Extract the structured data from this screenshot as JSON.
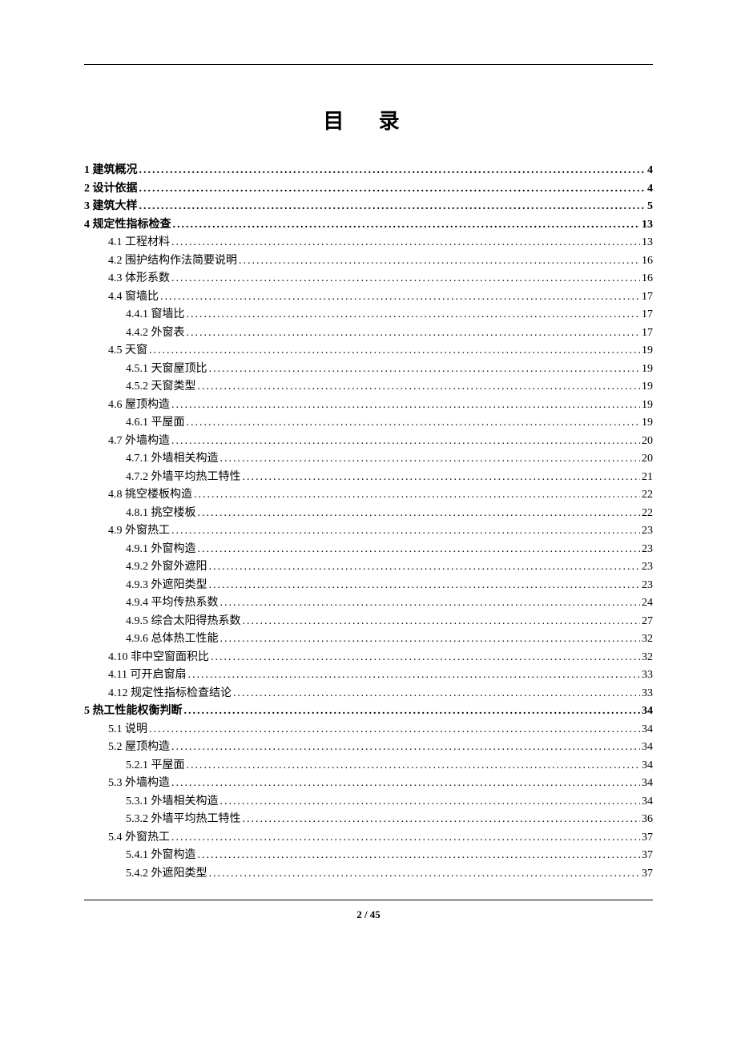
{
  "title": "目 录",
  "page_indicator": "2 / 45",
  "toc": [
    {
      "level": 0,
      "label": "1 建筑概况",
      "page": "4"
    },
    {
      "level": 0,
      "label": "2 设计依据",
      "page": "4"
    },
    {
      "level": 0,
      "label": "3 建筑大样",
      "page": "5"
    },
    {
      "level": 0,
      "label": "4 规定性指标检查",
      "page": "13"
    },
    {
      "level": 1,
      "label": "4.1 工程材料",
      "page": "13"
    },
    {
      "level": 1,
      "label": "4.2 围护结构作法简要说明",
      "page": "16"
    },
    {
      "level": 1,
      "label": "4.3 体形系数",
      "page": "16"
    },
    {
      "level": 1,
      "label": "4.4 窗墙比",
      "page": "17"
    },
    {
      "level": 2,
      "label": "4.4.1 窗墙比",
      "page": "17"
    },
    {
      "level": 2,
      "label": "4.4.2 外窗表",
      "page": "17"
    },
    {
      "level": 1,
      "label": "4.5 天窗",
      "page": "19"
    },
    {
      "level": 2,
      "label": "4.5.1 天窗屋顶比",
      "page": "19"
    },
    {
      "level": 2,
      "label": "4.5.2 天窗类型",
      "page": "19"
    },
    {
      "level": 1,
      "label": "4.6 屋顶构造",
      "page": "19"
    },
    {
      "level": 2,
      "label": "4.6.1 平屋面",
      "page": "19"
    },
    {
      "level": 1,
      "label": "4.7 外墙构造",
      "page": "20"
    },
    {
      "level": 2,
      "label": "4.7.1 外墙相关构造",
      "page": "20"
    },
    {
      "level": 2,
      "label": "4.7.2 外墙平均热工特性",
      "page": "21"
    },
    {
      "level": 1,
      "label": "4.8 挑空楼板构造",
      "page": "22"
    },
    {
      "level": 2,
      "label": "4.8.1 挑空楼板",
      "page": "22"
    },
    {
      "level": 1,
      "label": "4.9 外窗热工",
      "page": "23"
    },
    {
      "level": 2,
      "label": "4.9.1 外窗构造",
      "page": "23"
    },
    {
      "level": 2,
      "label": "4.9.2 外窗外遮阳",
      "page": "23"
    },
    {
      "level": 2,
      "label": "4.9.3 外遮阳类型",
      "page": "23"
    },
    {
      "level": 2,
      "label": "4.9.4 平均传热系数",
      "page": "24"
    },
    {
      "level": 2,
      "label": "4.9.5 综合太阳得热系数",
      "page": "27"
    },
    {
      "level": 2,
      "label": "4.9.6 总体热工性能",
      "page": "32"
    },
    {
      "level": 1,
      "label": "4.10 非中空窗面积比",
      "page": "32"
    },
    {
      "level": 1,
      "label": "4.11 可开启窗扇",
      "page": "33"
    },
    {
      "level": 1,
      "label": "4.12 规定性指标检查结论",
      "page": "33"
    },
    {
      "level": 0,
      "label": "5 热工性能权衡判断",
      "page": "34"
    },
    {
      "level": 1,
      "label": "5.1 说明",
      "page": "34"
    },
    {
      "level": 1,
      "label": "5.2 屋顶构造",
      "page": "34"
    },
    {
      "level": 2,
      "label": "5.2.1 平屋面",
      "page": "34"
    },
    {
      "level": 1,
      "label": "5.3 外墙构造",
      "page": "34"
    },
    {
      "level": 2,
      "label": "5.3.1 外墙相关构造",
      "page": "34"
    },
    {
      "level": 2,
      "label": "5.3.2 外墙平均热工特性",
      "page": "36"
    },
    {
      "level": 1,
      "label": "5.4 外窗热工",
      "page": "37"
    },
    {
      "level": 2,
      "label": "5.4.1 外窗构造",
      "page": "37"
    },
    {
      "level": 2,
      "label": "5.4.2 外遮阳类型",
      "page": "37"
    }
  ]
}
